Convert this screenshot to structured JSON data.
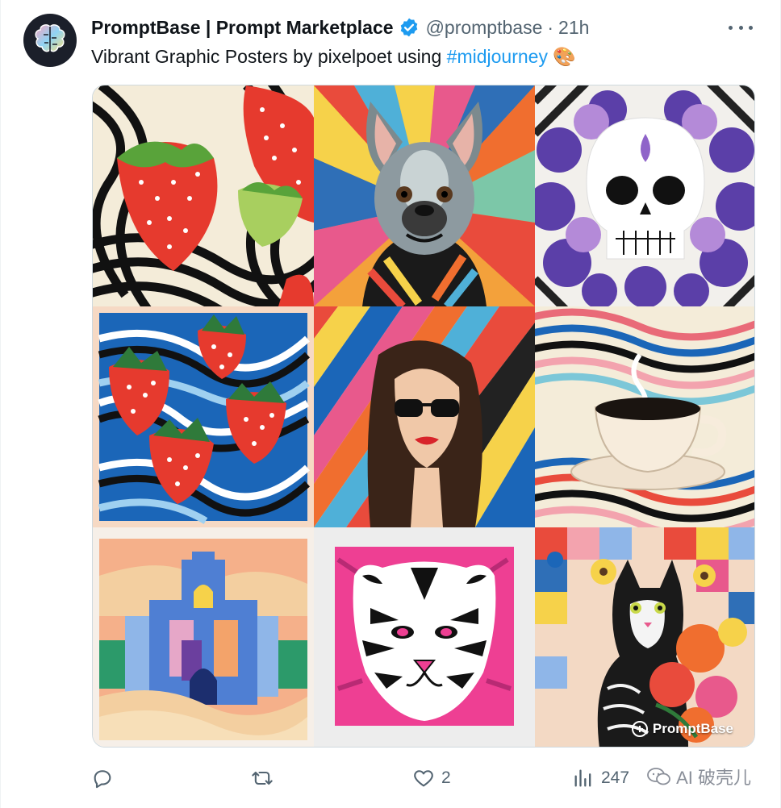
{
  "tweet": {
    "author_name": "PromptBase | Prompt Marketplace",
    "handle": "@promptbase",
    "separator": "·",
    "time": "21h",
    "text_prefix": "Vibrant Graphic Posters by pixelpoet using ",
    "hashtag": "#midjourney",
    "emoji": "🎨"
  },
  "images": [
    {
      "subject": "strawberries on wavy black and white stripes",
      "icon": "strawberry-poster"
    },
    {
      "subject": "french bulldog with rainbow rays",
      "icon": "bulldog-poster"
    },
    {
      "subject": "sugar skull with purple flowers",
      "icon": "skull-poster"
    },
    {
      "subject": "strawberries on blue wavy stripes",
      "icon": "strawberry-blue-poster"
    },
    {
      "subject": "woman with sunglasses and diagonal stripes",
      "icon": "woman-poster"
    },
    {
      "subject": "coffee cup on colorful waves",
      "icon": "coffee-poster"
    },
    {
      "subject": "geometric desert city",
      "icon": "city-poster"
    },
    {
      "subject": "pink tiger face",
      "icon": "tiger-poster"
    },
    {
      "subject": "cat with flowers",
      "icon": "cat-poster"
    }
  ],
  "watermark": "PromptBase",
  "actions": {
    "reply_count": "",
    "retweet_count": "",
    "like_count": "2",
    "views_count": "247"
  },
  "overlay": {
    "wechat_label": "AI 破壳儿"
  },
  "colors": {
    "hashtag": "#1d9bf0",
    "verified": "#1d9bf0",
    "secondary_text": "#536471"
  }
}
